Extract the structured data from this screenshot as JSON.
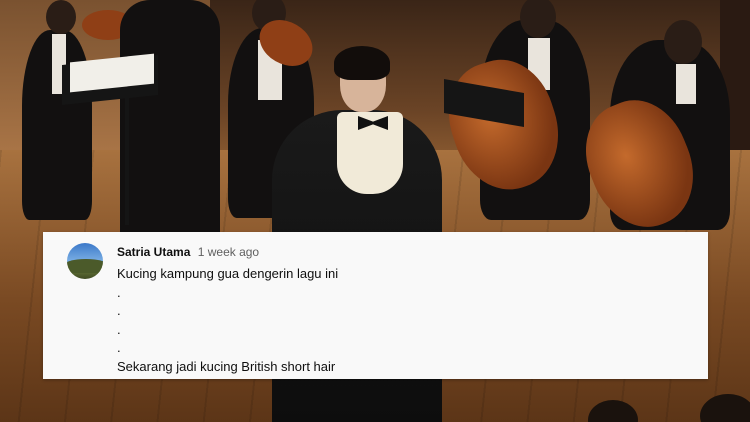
{
  "comment": {
    "author": "Satria Utama",
    "timestamp": "1 week ago",
    "lines": [
      "Kucing kampung gua dengerin lagu ini",
      ".",
      ".",
      ".",
      ".",
      "Sekarang jadi kucing British short hair"
    ]
  },
  "colors": {
    "card_background": "#f9f9f9",
    "author_text": "#0f0f0f",
    "timestamp_text": "#606060",
    "stage_floor": "#a8723f"
  },
  "icons": {
    "avatar": "landscape-avatar"
  }
}
